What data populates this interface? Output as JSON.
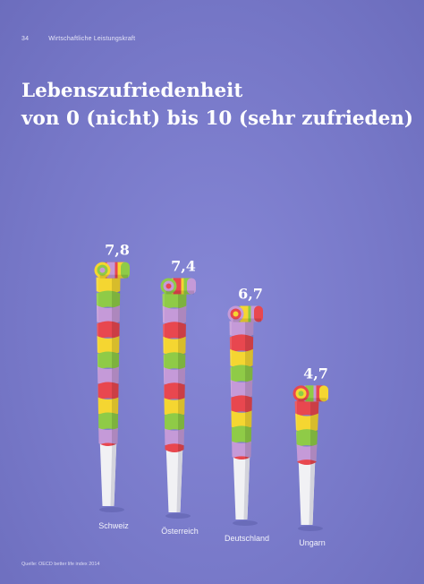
{
  "header": {
    "page_number": "34",
    "section": "Wirtschaftliche Leistungskraft"
  },
  "title_line1": "Lebenszufriedenheit",
  "title_line2": "von 0 (nicht) bis 10 (sehr zufrieden)",
  "source": "Quelle: OECD better life index 2014",
  "value_labels": [
    "7,8",
    "7,4",
    "6,7",
    "4,7"
  ],
  "colors": {
    "background": "#7b7ccb",
    "stripes": [
      "#e8474f",
      "#f5d631",
      "#8fcb47",
      "#c59ad8"
    ],
    "mouthpiece": "#f1f1f4"
  },
  "chart_data": {
    "type": "bar",
    "categories": [
      "Schweiz",
      "Österreich",
      "Deutschland",
      "Ungarn"
    ],
    "values": [
      7.8,
      7.4,
      6.7,
      4.7
    ],
    "title": "Lebenszufriedenheit von 0 (nicht) bis 10 (sehr zufrieden)",
    "ylim": [
      0,
      10
    ],
    "grid": false,
    "legend": "none"
  }
}
